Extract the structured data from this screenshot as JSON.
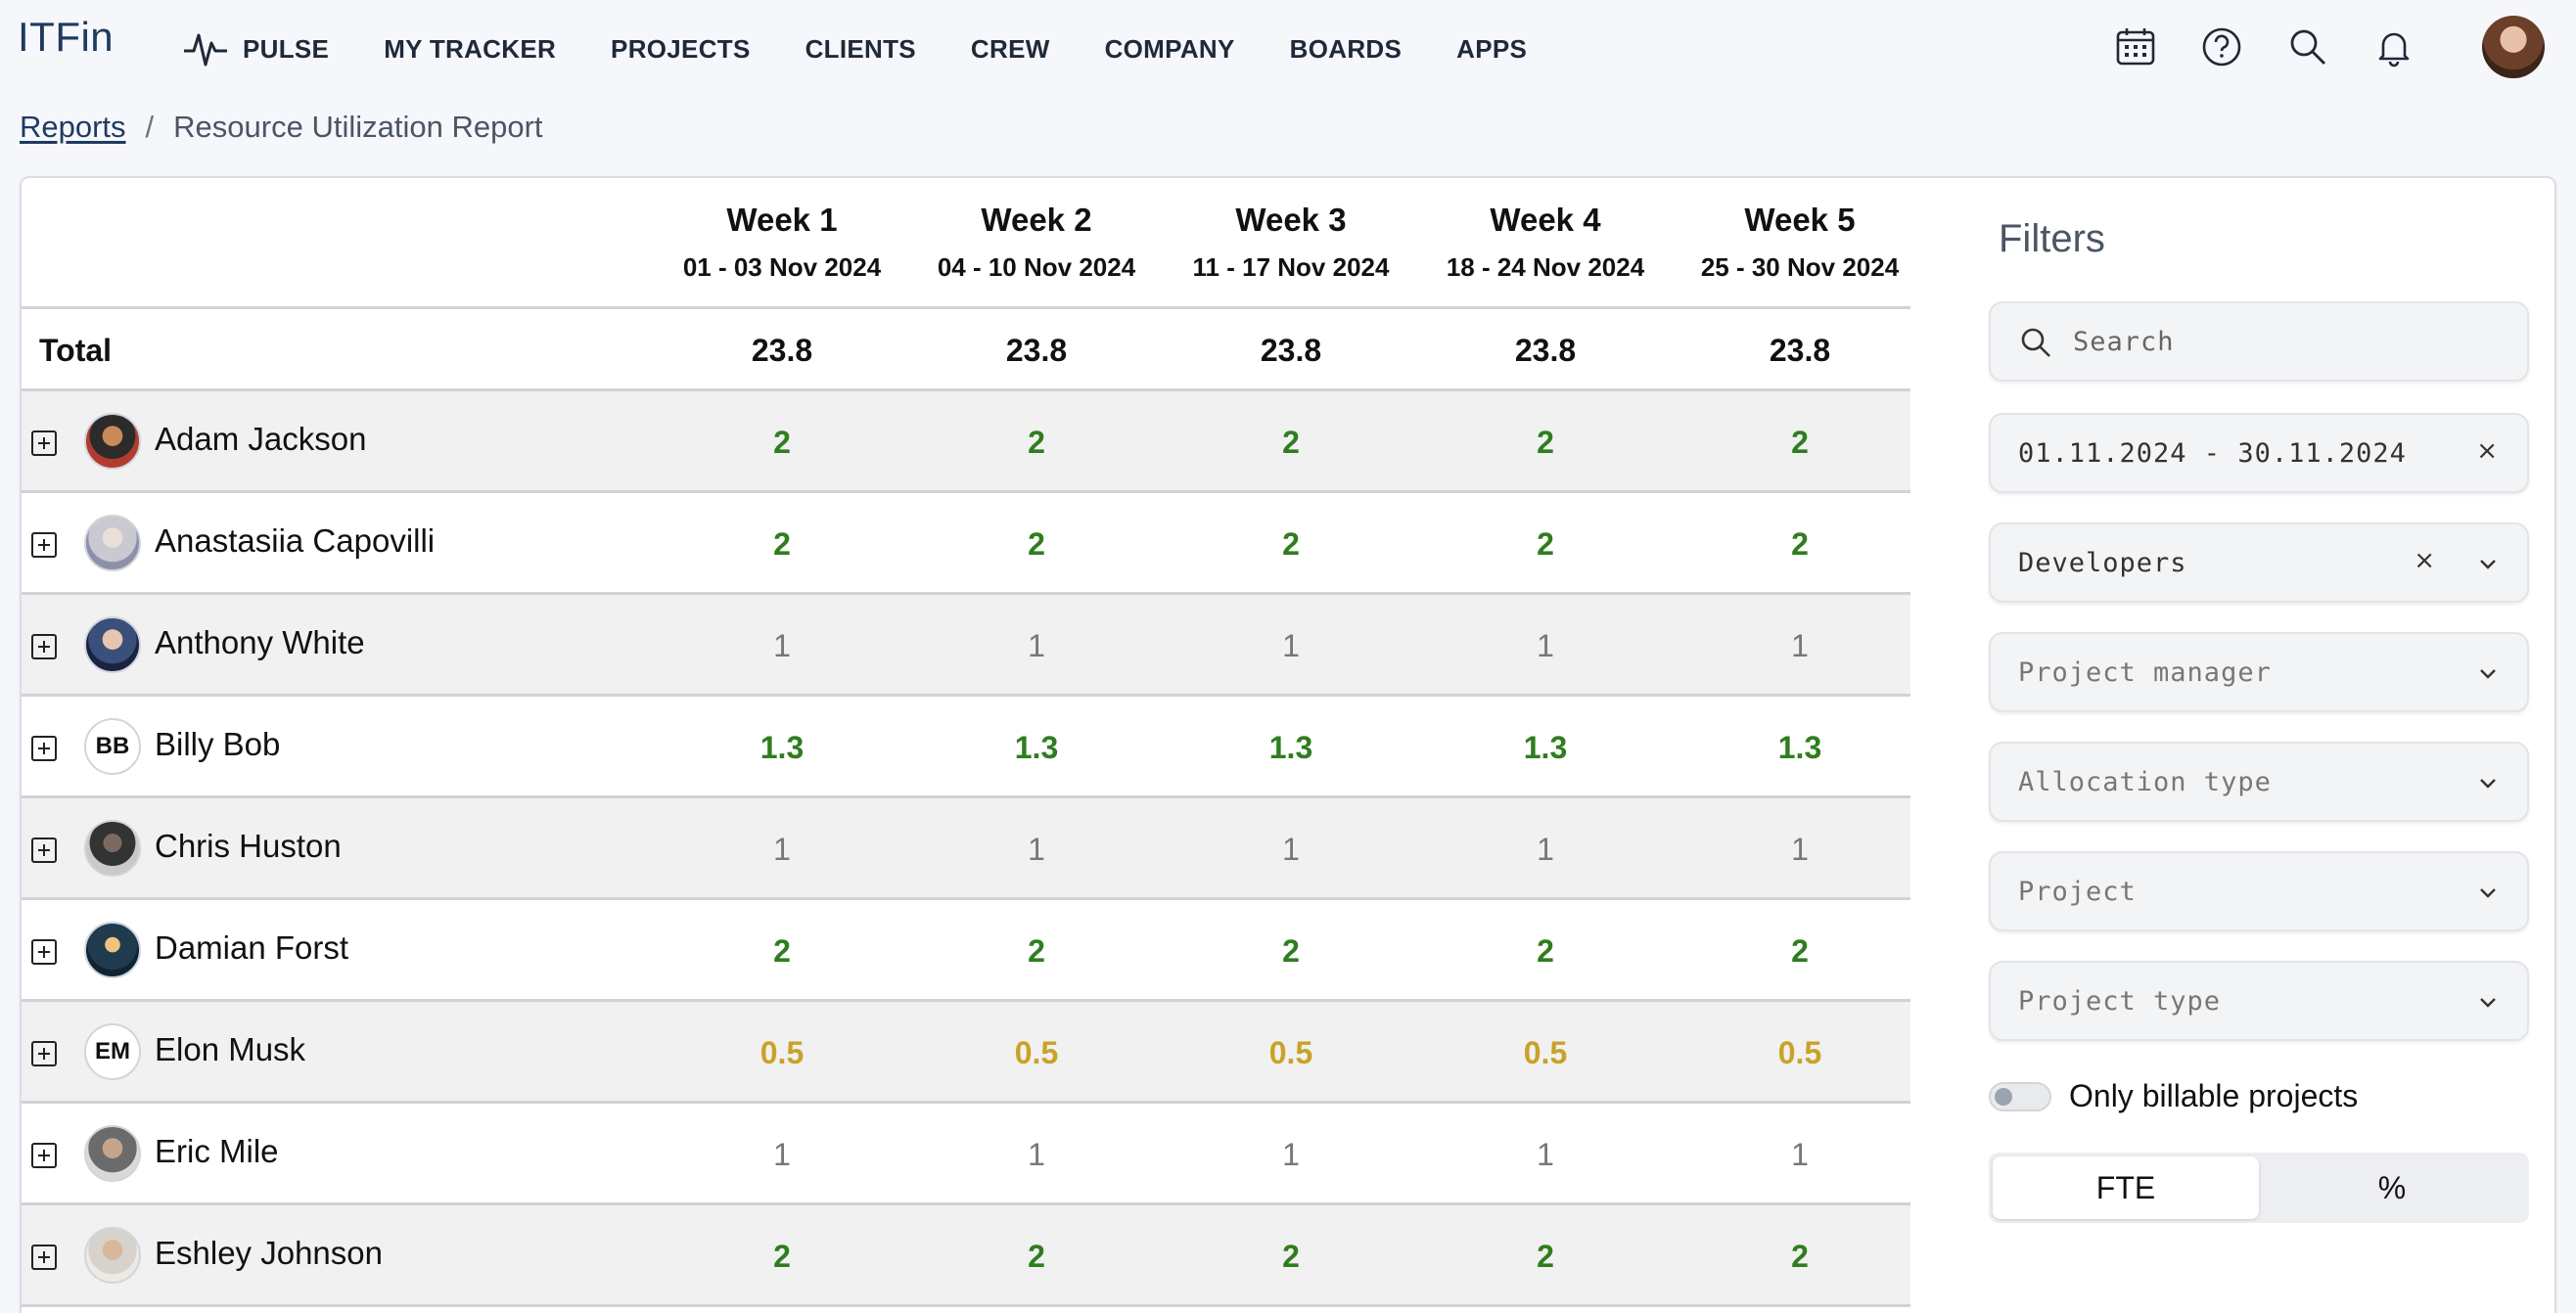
{
  "app": {
    "logo": "ITFin"
  },
  "nav": {
    "items": [
      {
        "label": "PULSE",
        "icon": "pulse-icon"
      },
      {
        "label": "MY TRACKER"
      },
      {
        "label": "PROJECTS"
      },
      {
        "label": "CLIENTS"
      },
      {
        "label": "CREW"
      },
      {
        "label": "COMPANY"
      },
      {
        "label": "BOARDS"
      },
      {
        "label": "APPS"
      }
    ],
    "icons": [
      "calendar-icon",
      "help-icon",
      "search-icon",
      "bell-icon",
      "user-avatar"
    ]
  },
  "breadcrumb": {
    "parent": "Reports",
    "separator": "/",
    "current": "Resource Utilization Report"
  },
  "table": {
    "weeks": [
      {
        "title": "Week 1",
        "range": "01 - 03 Nov 2024"
      },
      {
        "title": "Week 2",
        "range": "04 - 10 Nov 2024"
      },
      {
        "title": "Week 3",
        "range": "11 - 17 Nov 2024"
      },
      {
        "title": "Week 4",
        "range": "18 - 24 Nov 2024"
      },
      {
        "title": "Week 5",
        "range": "25 - 30 Nov 2024"
      }
    ],
    "total": {
      "label": "Total",
      "values": [
        "23.8",
        "23.8",
        "23.8",
        "23.8",
        "23.8"
      ]
    },
    "rows": [
      {
        "name": "Adam Jackson",
        "initials": "",
        "values": [
          "2",
          "2",
          "2",
          "2",
          "2"
        ],
        "status": "green"
      },
      {
        "name": "Anastasiia Capovilli",
        "initials": "",
        "values": [
          "2",
          "2",
          "2",
          "2",
          "2"
        ],
        "status": "green"
      },
      {
        "name": "Anthony White",
        "initials": "",
        "values": [
          "1",
          "1",
          "1",
          "1",
          "1"
        ],
        "status": "gray"
      },
      {
        "name": "Billy Bob",
        "initials": "BB",
        "values": [
          "1.3",
          "1.3",
          "1.3",
          "1.3",
          "1.3"
        ],
        "status": "green"
      },
      {
        "name": "Chris Huston",
        "initials": "",
        "values": [
          "1",
          "1",
          "1",
          "1",
          "1"
        ],
        "status": "gray"
      },
      {
        "name": "Damian Forst",
        "initials": "",
        "values": [
          "2",
          "2",
          "2",
          "2",
          "2"
        ],
        "status": "green"
      },
      {
        "name": "Elon Musk",
        "initials": "EM",
        "values": [
          "0.5",
          "0.5",
          "0.5",
          "0.5",
          "0.5"
        ],
        "status": "gold"
      },
      {
        "name": "Eric Mile",
        "initials": "",
        "values": [
          "1",
          "1",
          "1",
          "1",
          "1"
        ],
        "status": "gray"
      },
      {
        "name": "Eshley Johnson",
        "initials": "",
        "values": [
          "2",
          "2",
          "2",
          "2",
          "2"
        ],
        "status": "green"
      }
    ]
  },
  "filters": {
    "title": "Filters",
    "search_placeholder": "Search",
    "date_range": "01.11.2024 - 30.11.2024",
    "department": "Developers",
    "project_manager_placeholder": "Project manager",
    "allocation_type_placeholder": "Allocation type",
    "project_placeholder": "Project",
    "project_type_placeholder": "Project type",
    "billable_label": "Only billable projects",
    "billable_on": false,
    "mode_options": [
      "FTE",
      "%"
    ],
    "mode_selected": "FTE",
    "clear_glyph": "×"
  },
  "colors": {
    "green": "#2f7d1f",
    "gray": "#777777",
    "gold": "#c9a227",
    "brand": "#1f3a5f"
  }
}
